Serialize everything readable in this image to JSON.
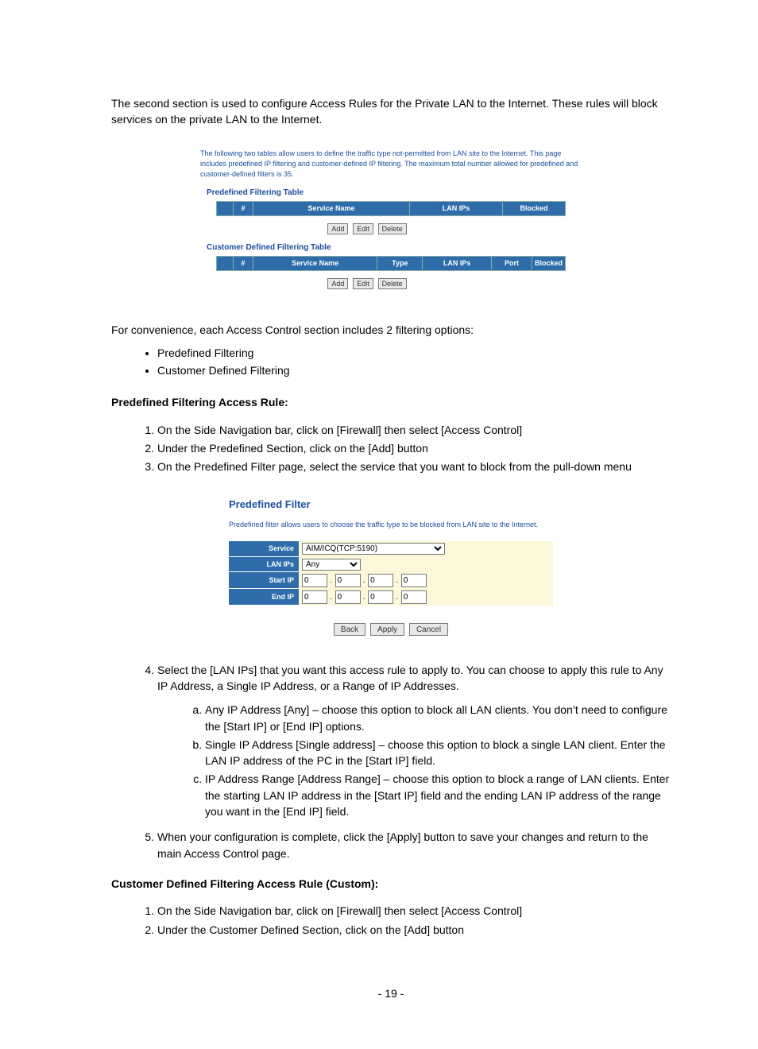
{
  "intro": "The second section is used to configure Access Rules for the Private LAN to the Internet.  These rules will block services on the private LAN to the Internet.",
  "shot1": {
    "note": "The following two tables allow users to define the traffic type not-permitted from LAN site to the Internet. This page includes predefined IP filtering and customer-defined IP filtering. The maximum total number allowed for predefined and customer-defined filters is 35.",
    "t1_title": "Predefined Filtering Table",
    "t1_h": {
      "n": "#",
      "service": "Service Name",
      "lan": "LAN IPs",
      "blocked": "Blocked"
    },
    "t2_title": "Customer Defined Filtering Table",
    "t2_h": {
      "n": "#",
      "service": "Service Name",
      "type": "Type",
      "lan": "LAN IPs",
      "port": "Port",
      "blocked": "Blocked"
    },
    "btn_add": "Add",
    "btn_edit": "Edit",
    "btn_delete": "Delete"
  },
  "mid_line": "For convenience, each Access Control section includes 2 filtering options:",
  "bullet1": "Predefined Filtering",
  "bullet2": "Customer Defined Filtering",
  "predef_title": "Predefined Filtering Access Rule:",
  "predef_steps": {
    "s1": "On the Side Navigation bar, click on [Firewall] then select [Access Control]",
    "s2": "Under the Predefined Section, click on the [Add] button",
    "s3": "On the Predefined Filter page, select the service that you want to block from the pull-down menu"
  },
  "shot2": {
    "title": "Predefined Filter",
    "desc": "Predefined filter allows users to choose the traffic type to be blocked from LAN site to the Internet.",
    "lab_service": "Service",
    "lab_lan": "LAN IPs",
    "lab_start": "Start IP",
    "lab_end": "End IP",
    "service_opt": "AIM/ICQ(TCP:5190)",
    "lan_opt": "Any",
    "ip": "0",
    "btn_back": "Back",
    "btn_apply": "Apply",
    "btn_cancel": "Cancel"
  },
  "step4": "Select the [LAN IPs] that you want this access rule to apply to. You can choose to apply this rule to Any IP Address, a Single IP Address, or a Range of IP Addresses.",
  "sub": {
    "a": "Any IP Address [Any] – choose this option to block all LAN clients.  You don’t need to configure the [Start IP] or [End IP] options.",
    "b": "Single IP Address [Single address] – choose this option to block a single LAN client.  Enter the LAN IP address of the PC in the [Start IP] field.",
    "c": "IP Address Range [Address Range] – choose this option to block a range of LAN clients.  Enter the starting LAN IP address in the [Start IP] field and the ending LAN IP address of the range you want in the [End IP] field."
  },
  "step5": "When your configuration is complete, click the [Apply] button to save your changes and return to the main Access Control page.",
  "cust_title": "Customer Defined Filtering Access Rule (Custom):",
  "cust_steps": {
    "s1": "On the Side Navigation bar, click on [Firewall] then select [Access Control]",
    "s2": "Under the Customer Defined Section, click on the [Add] button"
  },
  "page_num": "- 19 -"
}
